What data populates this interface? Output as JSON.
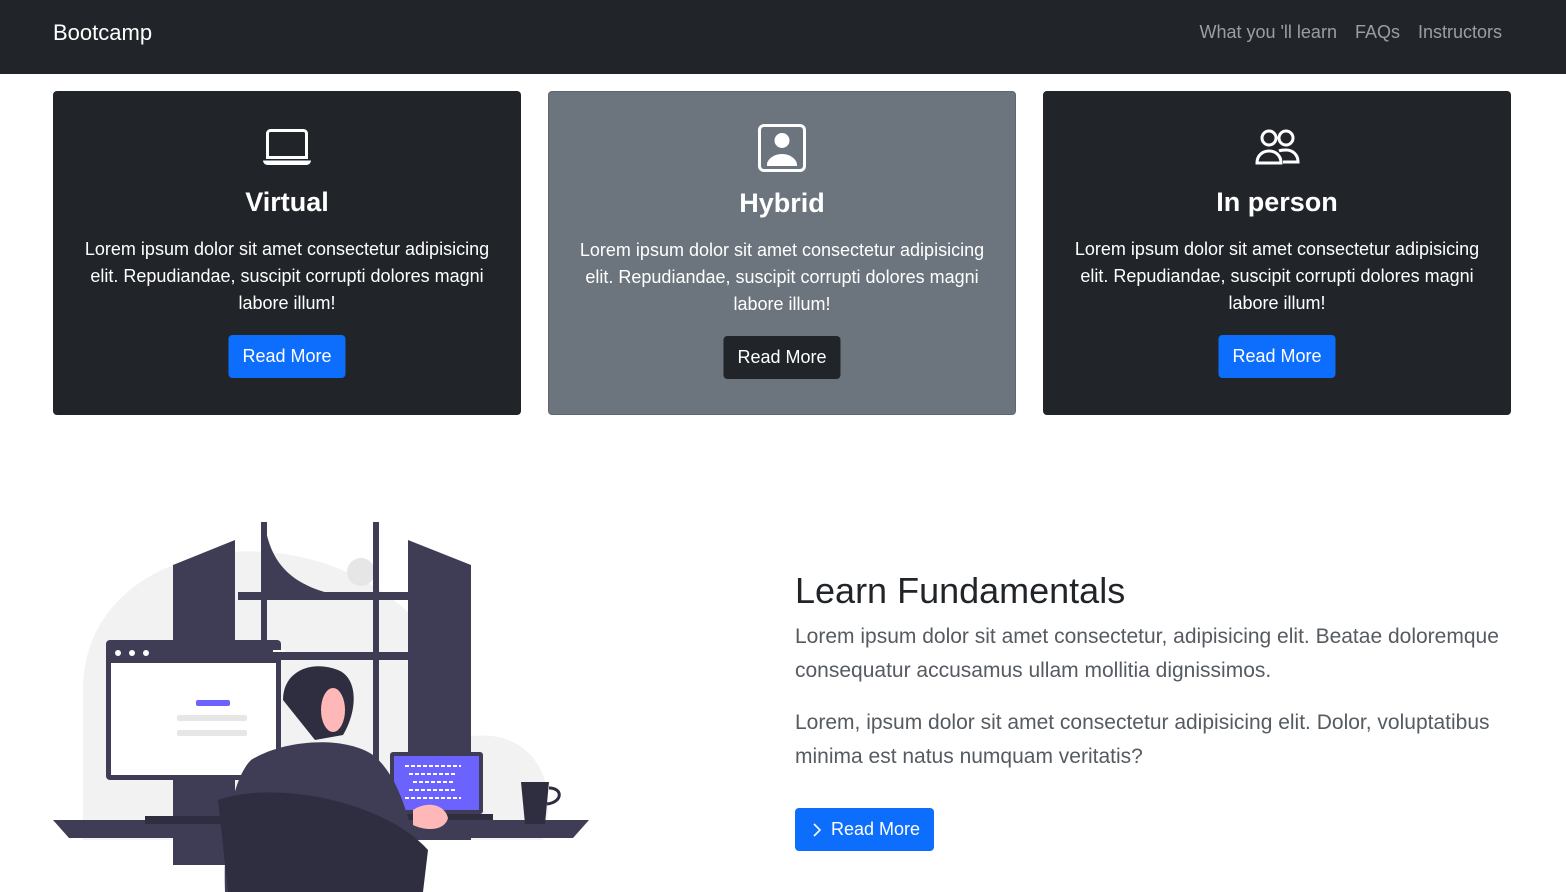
{
  "navbar": {
    "brand": "Bootcamp",
    "links": [
      "What you 'll learn",
      "FAQs",
      "Instructors"
    ]
  },
  "cards": [
    {
      "icon": "laptop-icon",
      "title": "Virtual",
      "text": "Lorem ipsum dolor sit amet consectetur adipisicing elit. Repudiandae, suscipit corrupti dolores magni labore illum!",
      "button": "Read More"
    },
    {
      "icon": "person-badge-icon",
      "title": "Hybrid",
      "text": "Lorem ipsum dolor sit amet consectetur adipisicing elit. Repudiandae, suscipit corrupti dolores magni labore illum!",
      "button": "Read More"
    },
    {
      "icon": "people-icon",
      "title": "In person",
      "text": "Lorem ipsum dolor sit amet consectetur adipisicing elit. Repudiandae, suscipit corrupti dolores magni labore illum!",
      "button": "Read More"
    }
  ],
  "learn": {
    "title": "Learn Fundamentals",
    "paragraph1": "Lorem ipsum dolor sit amet consectetur, adipisicing elit. Beatae doloremque consequatur accusamus ullam mollitia dignissimos.",
    "paragraph2": "Lorem, ipsum dolor sit amet consectetur adipisicing elit. Dolor, voluptatibus minima est natus numquam veritatis?",
    "button": "Read More",
    "button_icon": "chevron-right-icon"
  },
  "colors": {
    "navbar_bg": "#212529",
    "primary": "#0d6efd",
    "card_dark": "#212529",
    "card_gray": "#6c757d",
    "illustration_accent": "#6c63ff"
  }
}
